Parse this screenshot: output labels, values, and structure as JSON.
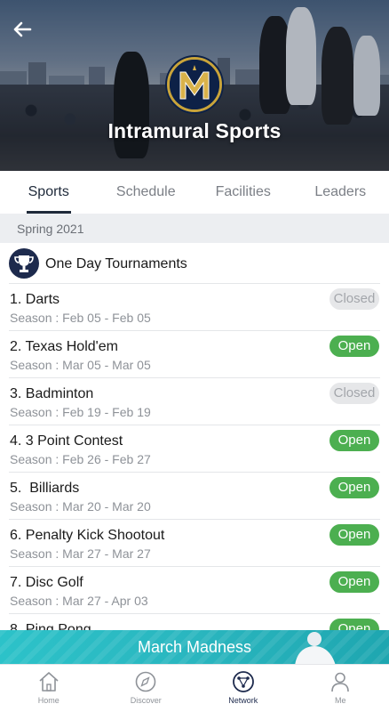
{
  "header": {
    "title": "Intramural Sports",
    "back_icon": "arrow-left-icon",
    "logo": "university-crest-logo"
  },
  "tabs": [
    {
      "label": "Sports",
      "active": true
    },
    {
      "label": "Schedule",
      "active": false
    },
    {
      "label": "Facilities",
      "active": false
    },
    {
      "label": "Leaders",
      "active": false
    }
  ],
  "season_label": "Spring 2021",
  "section": {
    "icon": "trophy-icon",
    "title": "One Day Tournaments"
  },
  "items": [
    {
      "name": "1. Darts",
      "season": "Season : Feb 05 - Feb 05",
      "status": "Closed"
    },
    {
      "name": "2. Texas Hold'em",
      "season": "Season : Mar 05 - Mar 05",
      "status": "Open"
    },
    {
      "name": "3. Badminton",
      "season": "Season : Feb 19 - Feb 19",
      "status": "Closed"
    },
    {
      "name": "4. 3 Point Contest",
      "season": "Season : Feb 26 - Feb 27",
      "status": "Open"
    },
    {
      "name": "5.  Billiards",
      "season": "Season : Mar 20 - Mar 20",
      "status": "Open"
    },
    {
      "name": "6. Penalty Kick Shootout",
      "season": "Season : Mar 27 - Mar 27",
      "status": "Open"
    },
    {
      "name": "7. Disc Golf",
      "season": "Season : Mar 27 - Apr 03",
      "status": "Open"
    },
    {
      "name": "8. Ping Pong",
      "season": "",
      "status": "Open"
    }
  ],
  "banner": {
    "text": "March Madness"
  },
  "bottom_nav": [
    {
      "label": "Home",
      "icon": "home-icon",
      "active": false
    },
    {
      "label": "Discover",
      "icon": "compass-icon",
      "active": false
    },
    {
      "label": "Network",
      "icon": "network-icon",
      "active": true
    },
    {
      "label": "Me",
      "icon": "person-icon",
      "active": false
    }
  ],
  "colors": {
    "open": "#4caf50",
    "closed_bg": "#e6e7e9",
    "navy": "#1d2a4d",
    "banner": "#2cc2c9"
  }
}
